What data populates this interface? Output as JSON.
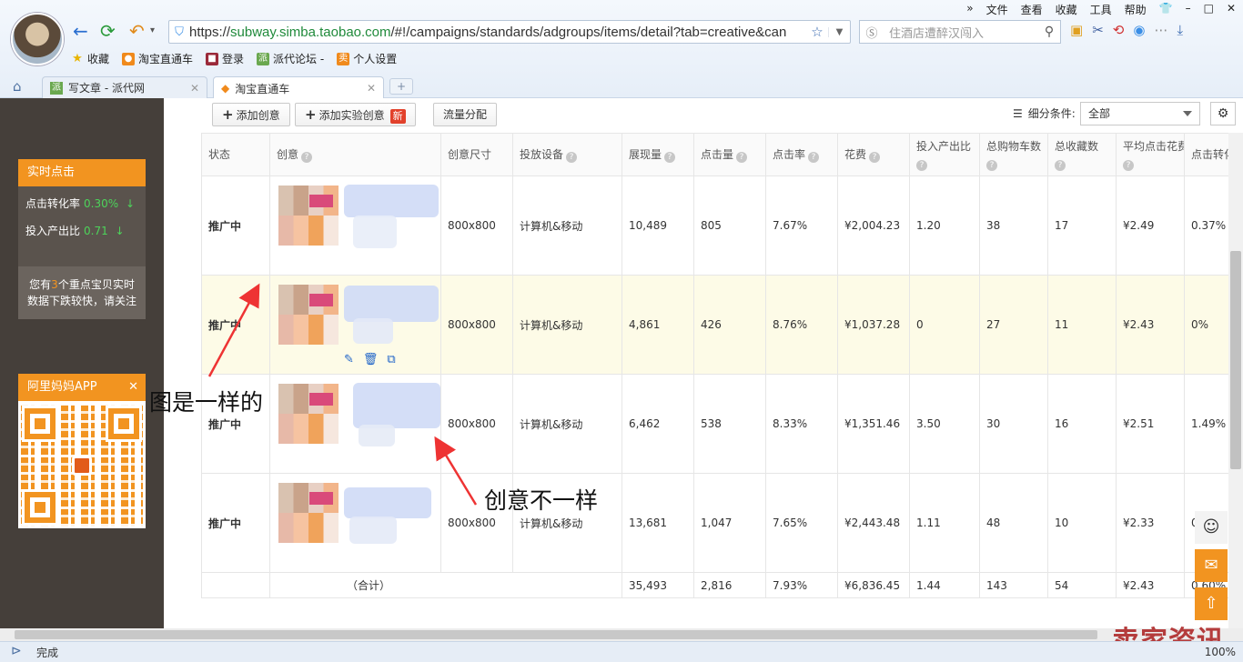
{
  "browser": {
    "menu": [
      "文件",
      "查看",
      "收藏",
      "工具",
      "帮助"
    ],
    "url_prefix": "https://",
    "url_host": "subway.simba.taobao.com",
    "url_path": "/#!/campaigns/standards/adgroups/items/detail?tab=creative&can",
    "search_placeholder": "住酒店遭醉汉闯入",
    "bookmarks": [
      "收藏",
      "淘宝直通车",
      "登录",
      "派代论坛 -",
      "个人设置"
    ],
    "tabs": [
      {
        "label": "写文章 - 派代网",
        "active": false
      },
      {
        "label": "淘宝直通车",
        "active": true
      }
    ],
    "status_text": "完成",
    "zoom": "100%"
  },
  "sidebar": {
    "realtime_title": "实时点击",
    "ctr_label": "点击转化率",
    "ctr_value": "0.30%",
    "roi_label": "投入产出比",
    "roi_value": "0.71",
    "notice_pre": "您有",
    "notice_num": "3",
    "notice_post": "个重点宝贝实时数据下跌较快，请关注",
    "app_title": "阿里妈妈APP"
  },
  "toolbar": {
    "add_creative": "添加创意",
    "add_test_creative": "添加实验创意",
    "new_badge": "新",
    "traffic_split": "流量分配",
    "filter_label": "细分条件:",
    "filter_value": "全部"
  },
  "table": {
    "headers": [
      "状态",
      "创意",
      "创意尺寸",
      "投放设备",
      "展现量",
      "点击量",
      "点击率",
      "花费",
      "投入产出比",
      "总购物车数",
      "总收藏数",
      "平均点击花费",
      "点击转化"
    ],
    "rows": [
      {
        "status": "推广中",
        "size": "800x800",
        "device": "计算机&移动",
        "impressions": "10,489",
        "clicks": "805",
        "ctr": "7.67%",
        "cost": "¥2,004.23",
        "roi": "1.20",
        "cart": "38",
        "fav": "17",
        "cpc": "¥2.49",
        "cvr": "0.37%"
      },
      {
        "status": "推广中",
        "size": "800x800",
        "device": "计算机&移动",
        "impressions": "4,861",
        "clicks": "426",
        "ctr": "8.76%",
        "cost": "¥1,037.28",
        "roi": "0",
        "cart": "27",
        "fav": "11",
        "cpc": "¥2.43",
        "cvr": "0%"
      },
      {
        "status": "推广中",
        "size": "800x800",
        "device": "计算机&移动",
        "impressions": "6,462",
        "clicks": "538",
        "ctr": "8.33%",
        "cost": "¥1,351.46",
        "roi": "3.50",
        "cart": "30",
        "fav": "16",
        "cpc": "¥2.51",
        "cvr": "1.49%"
      },
      {
        "status": "推广中",
        "size": "800x800",
        "device": "计算机&移动",
        "impressions": "13,681",
        "clicks": "1,047",
        "ctr": "7.65%",
        "cost": "¥2,443.48",
        "roi": "1.11",
        "cart": "48",
        "fav": "10",
        "cpc": "¥2.33",
        "cvr": "0"
      }
    ],
    "total": {
      "label": "（合计）",
      "impressions": "35,493",
      "clicks": "2,816",
      "ctr": "7.93%",
      "cost": "¥6,836.45",
      "roi": "1.44",
      "cart": "143",
      "fav": "54",
      "cpc": "¥2.43",
      "cvr": "0.60%"
    }
  },
  "annotations": {
    "same_image": "图是一样的",
    "different_creative": "创意不一样"
  },
  "watermark": "卖家资讯"
}
